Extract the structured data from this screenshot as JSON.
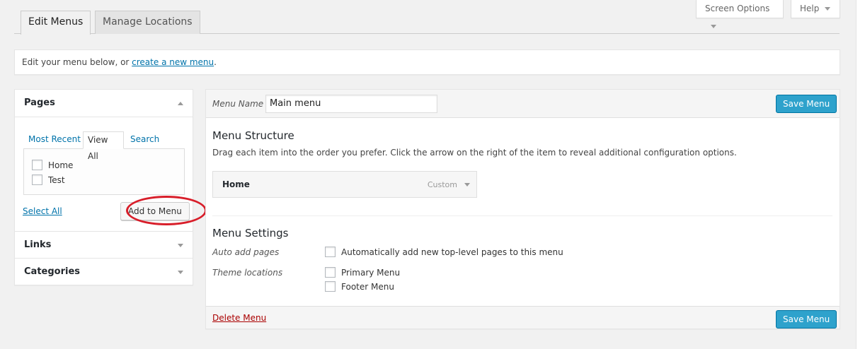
{
  "screen_meta": {
    "screen_options_label": "Screen Options",
    "help_label": "Help"
  },
  "tabs": [
    {
      "label": "Edit Menus",
      "active": true
    },
    {
      "label": "Manage Locations",
      "active": false
    }
  ],
  "info": {
    "prefix": "Edit your menu below, or ",
    "link": "create a new menu",
    "suffix": "."
  },
  "sidebar": {
    "pages": {
      "title": "Pages",
      "subtabs": [
        "Most Recent",
        "View All",
        "Search"
      ],
      "active_subtab": "View All",
      "items": [
        "Home",
        "Test"
      ],
      "select_all": "Select All",
      "add_button": "Add to Menu"
    },
    "links_title": "Links",
    "categories_title": "Categories"
  },
  "menu": {
    "name_label": "Menu Name",
    "name_value": "Main menu",
    "save_label": "Save Menu",
    "structure_title": "Menu Structure",
    "structure_desc": "Drag each item into the order you prefer. Click the arrow on the right of the item to reveal additional configuration options.",
    "items": [
      {
        "title": "Home",
        "type": "Custom"
      }
    ],
    "settings_title": "Menu Settings",
    "auto_add_label": "Auto add pages",
    "auto_add_option": "Automatically add new top-level pages to this menu",
    "theme_locations_label": "Theme locations",
    "locations": [
      "Primary Menu",
      "Footer Menu"
    ],
    "delete_label": "Delete Menu"
  },
  "colors": {
    "primary_button": "#2ea2cc",
    "link": "#0073aa",
    "delete": "#aa0000",
    "highlight_ring": "#d81e2a"
  }
}
